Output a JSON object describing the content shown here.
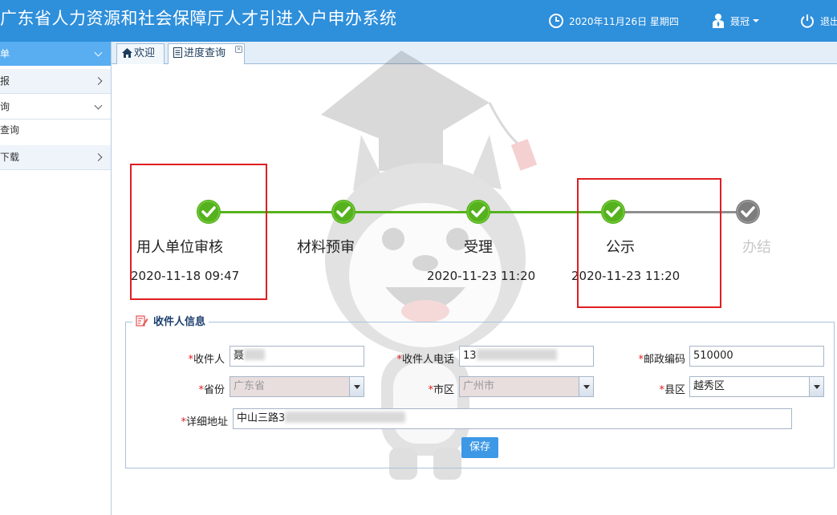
{
  "header": {
    "title": "广东省人力资源和社会保障厅人才引进入户申办系统",
    "datetime": "2020年11月26日 星期四",
    "user_name": "聂冠",
    "logout_label": "退出"
  },
  "sidebar": {
    "active_item": "单",
    "items": [
      {
        "label": "报"
      },
      {
        "label": "询"
      },
      {
        "label": "查询"
      },
      {
        "label": "下载"
      }
    ]
  },
  "tabs": [
    {
      "label": "欢迎"
    },
    {
      "label": "进度查询"
    }
  ],
  "progress": {
    "steps": [
      {
        "label": "用人单位审核",
        "time": "2020-11-18 09:47",
        "status": "done"
      },
      {
        "label": "材料预审",
        "time": "",
        "status": "done"
      },
      {
        "label": "受理",
        "time": "2020-11-23 11:20",
        "status": "done"
      },
      {
        "label": "公示",
        "time": "2020-11-23 11:20",
        "status": "done"
      },
      {
        "label": "办结",
        "time": "",
        "status": "pending"
      }
    ]
  },
  "recipient": {
    "legend": "收件人信息",
    "required_mark": "*",
    "name_label": "收件人",
    "name_value": "聂",
    "phone_label": "收件人电话",
    "phone_value": "13",
    "postcode_label": "邮政编码",
    "postcode_value": "510000",
    "province_label": "省份",
    "province_value": "广东省",
    "city_label": "市区",
    "city_value": "广州市",
    "district_label": "县区",
    "district_value": "越秀区",
    "address_label": "详细地址",
    "address_value": "中山三路3",
    "save_label": "保存"
  },
  "colors": {
    "header_bg": "#2e8fdb",
    "step_done": "#55b21e",
    "step_pending": "#8f8f8f",
    "highlight_box": "#e01e22"
  }
}
